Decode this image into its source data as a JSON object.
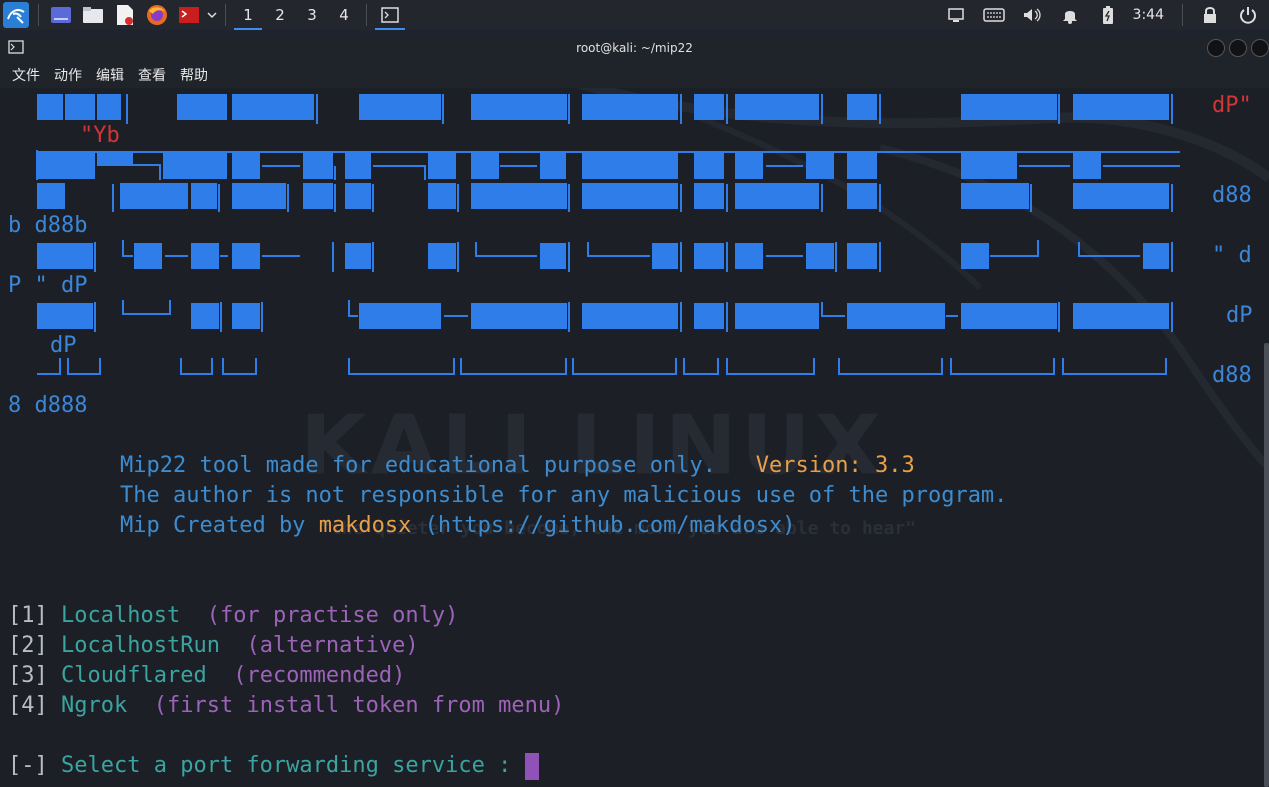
{
  "taskbar": {
    "workspaces": [
      "1",
      "2",
      "3",
      "4"
    ],
    "active_workspace": "1",
    "clock": "3:44",
    "launcher_icons": [
      "kali-menu-icon",
      "show-desktop-icon",
      "file-manager-icon",
      "text-editor-icon",
      "firefox-icon",
      "terminal-launcher-icon",
      "chevron-down-icon"
    ],
    "tray_icons": [
      "display-icon",
      "keyboard-icon",
      "volume-icon",
      "notification-bell-icon",
      "battery-icon",
      "lock-icon",
      "power-icon"
    ]
  },
  "window": {
    "title": "root@kali: ~/mip22",
    "menu": [
      "文件",
      "动作",
      "编辑",
      "查看",
      "帮助"
    ]
  },
  "terminal": {
    "banner_right": {
      "r1": "dP\"",
      "r2": "\"Yb",
      "r3": "d88",
      "r4": "b d88b",
      "r5": "\" d",
      "r6": "P \" dP",
      "r7": "dP",
      "r8": "dP",
      "r9": "d88",
      "r10": "8 d888"
    },
    "info1_text": "Mip22 tool made for educational purpose only.",
    "info1_version": "Version: 3.3",
    "info2": "The author is not responsible for any malicious use of the program.",
    "info3_prefix": "Mip Created by ",
    "info3_name": "makdosx",
    "info3_suffix": " (https://github.com/makdosx)",
    "options": [
      {
        "num": "1",
        "name": "Localhost",
        "note": "(for practise only)"
      },
      {
        "num": "2",
        "name": "LocalhostRun",
        "note": "(alternative)"
      },
      {
        "num": "3",
        "name": "Cloudflared",
        "note": "(recommended)"
      },
      {
        "num": "4",
        "name": "Ngrok",
        "note": "(first install token from menu)"
      }
    ],
    "prompt_marker": "[-]",
    "prompt": "Select a port forwarding service :",
    "watermark": "KALI LINUX",
    "watermark_sub": "\"the quieter you become, the more you are able to hear\""
  },
  "colors": {
    "banner_blue": "#2f7de8",
    "banner_red": "#d33535",
    "info_blue": "#3d8ccf",
    "version_orange": "#e8a048",
    "option_teal": "#3aa4a0",
    "option_note_purple": "#9c63b8",
    "cursor_purple": "#9052b8"
  }
}
